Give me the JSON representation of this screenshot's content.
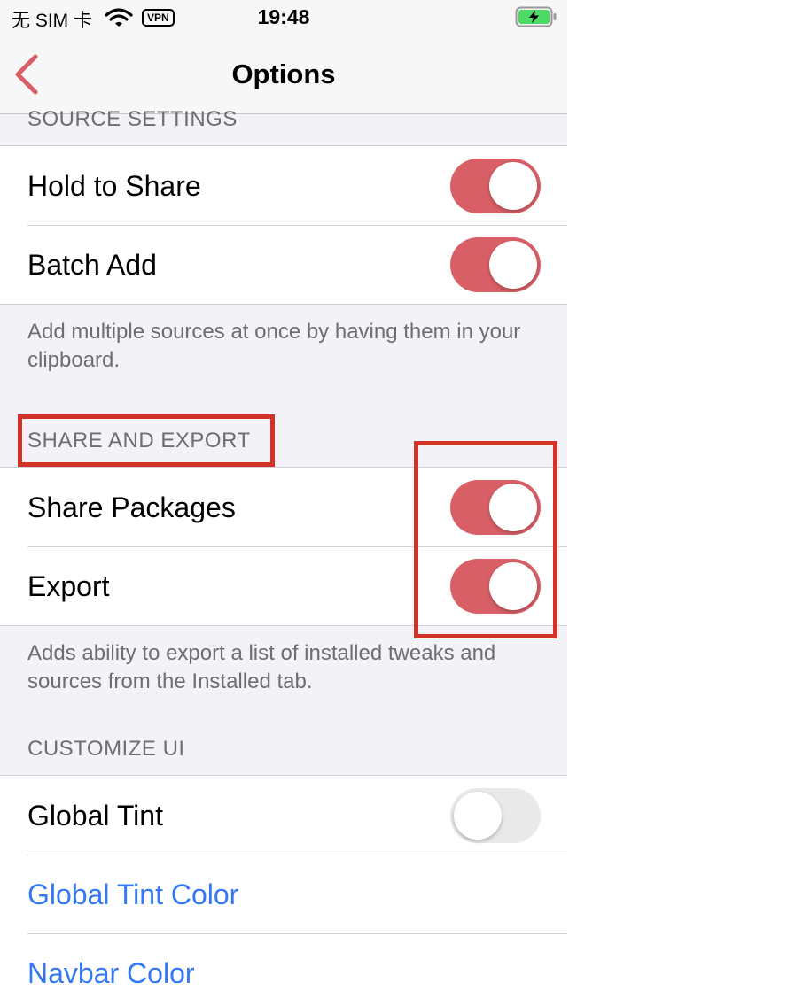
{
  "status_bar": {
    "carrier": "无 SIM 卡",
    "vpn": "VPN",
    "time": "19:48",
    "wifi_icon": "wifi-icon",
    "battery_icon": "battery-charging-icon"
  },
  "navbar": {
    "title": "Options",
    "back_icon": "chevron-left-icon"
  },
  "sections": {
    "source_settings": {
      "header": "SOURCE SETTINGS",
      "rows": [
        {
          "label": "Hold to Share",
          "toggle": true
        },
        {
          "label": "Batch Add",
          "toggle": true
        }
      ],
      "footer": "Add multiple sources at once by having them in your clipboard."
    },
    "share_export": {
      "header": "SHARE AND EXPORT",
      "rows": [
        {
          "label": "Share Packages",
          "toggle": true
        },
        {
          "label": "Export",
          "toggle": true
        }
      ],
      "footer": "Adds ability to export a list of installed tweaks and sources from the Installed tab."
    },
    "customize_ui": {
      "header": "CUSTOMIZE UI",
      "rows": [
        {
          "label": "Global Tint",
          "toggle": false
        },
        {
          "label": "Global Tint Color"
        },
        {
          "label": "Navbar Color"
        }
      ]
    }
  },
  "colors": {
    "accent": "#d95f66",
    "link": "#3478f6",
    "highlight": "#d23227"
  }
}
